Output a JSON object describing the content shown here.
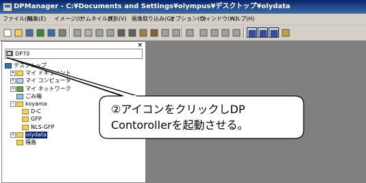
{
  "window": {
    "title": "DPManager - C:¥Documents and Settings¥olympus¥デスクトップ¥olydata"
  },
  "menubar": {
    "items": [
      {
        "label": "ファイル(F)"
      },
      {
        "label": "編集(E)"
      },
      {
        "label": "イメージ(I)"
      },
      {
        "label": "サムネイル(T)"
      },
      {
        "label": "表示(V)"
      },
      {
        "label": "画像取り込み(G)"
      },
      {
        "label": "オプション(O)"
      },
      {
        "label": "ウィンドウ(W)"
      },
      {
        "label": "ヘルプ(H)"
      }
    ]
  },
  "toolbar": {
    "buttons": [
      {
        "icon": "new-icon",
        "color": "#ffffff"
      },
      {
        "icon": "open-icon",
        "color": "#f0d060"
      },
      {
        "icon": "save-icon",
        "color": "#5a6a9a"
      },
      {
        "icon": "capture-icon",
        "color": "#3a8a3a"
      },
      {
        "icon": "import-icon",
        "color": "#3a6ea5"
      },
      {
        "icon": "print-icon",
        "color": "#808080"
      },
      {
        "icon": "edit-icon",
        "color": "#a0a0a0"
      },
      {
        "icon": "grid-icon",
        "color": "#b0b0b0"
      },
      {
        "icon": "crop-icon",
        "color": "#a0a0a0"
      },
      {
        "icon": "cut-icon",
        "color": "#a0a0a0"
      },
      {
        "icon": "scissors-icon",
        "color": "#606060"
      },
      {
        "icon": "copy-icon",
        "color": "#606060"
      },
      {
        "icon": "paste-icon",
        "color": "#a08040"
      },
      {
        "icon": "paste-special-icon",
        "color": "#806040"
      },
      {
        "icon": "undo-icon",
        "color": "#a0a0a0"
      },
      {
        "icon": "redo-icon",
        "color": "#a0a0a0"
      },
      {
        "icon": "help-icon",
        "color": "#a0a0a0"
      },
      {
        "icon": "zoom-in-icon",
        "color": "#a0a0a0"
      },
      {
        "icon": "zoom-out-icon",
        "color": "#a0a0a0"
      },
      {
        "icon": "fit-icon",
        "color": "#a0a0a0"
      },
      {
        "icon": "actual-size-icon",
        "color": "#a0a0a0"
      },
      {
        "icon": "view-large-icon",
        "color": "#3a4aa0"
      },
      {
        "icon": "view-medium-icon",
        "color": "#3a4aa0"
      },
      {
        "icon": "view-small-icon",
        "color": "#3a4aa0"
      },
      {
        "icon": "extra-icon",
        "color": "#c0a040"
      }
    ]
  },
  "left_pane": {
    "close_label": "×",
    "device_label": "DP70",
    "tree": [
      {
        "label": "デスクトップ",
        "icon": "desktop-icon",
        "level": 0,
        "expander": ""
      },
      {
        "label": "マイ ドキュメント",
        "icon": "my-documents-icon",
        "level": 1,
        "expander": "+"
      },
      {
        "label": "マイ コンピュータ",
        "icon": "my-computer-icon",
        "level": 1,
        "expander": "+"
      },
      {
        "label": "マイ ネットワーク",
        "icon": "my-network-icon",
        "level": 1,
        "expander": "+"
      },
      {
        "label": "ごみ箱",
        "icon": "recycle-bin-icon",
        "level": 1,
        "expander": ""
      },
      {
        "label": "koyama",
        "icon": "folder-icon",
        "level": 1,
        "expander": "-"
      },
      {
        "label": "D-C",
        "icon": "folder-icon",
        "level": 2,
        "expander": ""
      },
      {
        "label": "GFP",
        "icon": "folder-icon",
        "level": 2,
        "expander": ""
      },
      {
        "label": "NLS-GFP",
        "icon": "folder-icon",
        "level": 2,
        "expander": ""
      },
      {
        "label": "olydata",
        "icon": "folder-icon",
        "level": 1,
        "expander": "+",
        "selected": true
      },
      {
        "label": "福島",
        "icon": "folder-icon",
        "level": 1,
        "expander": ""
      }
    ]
  },
  "callout": {
    "line1": "②アイコンをクリックしDP",
    "line2": "Contorollerを起動させる。"
  }
}
